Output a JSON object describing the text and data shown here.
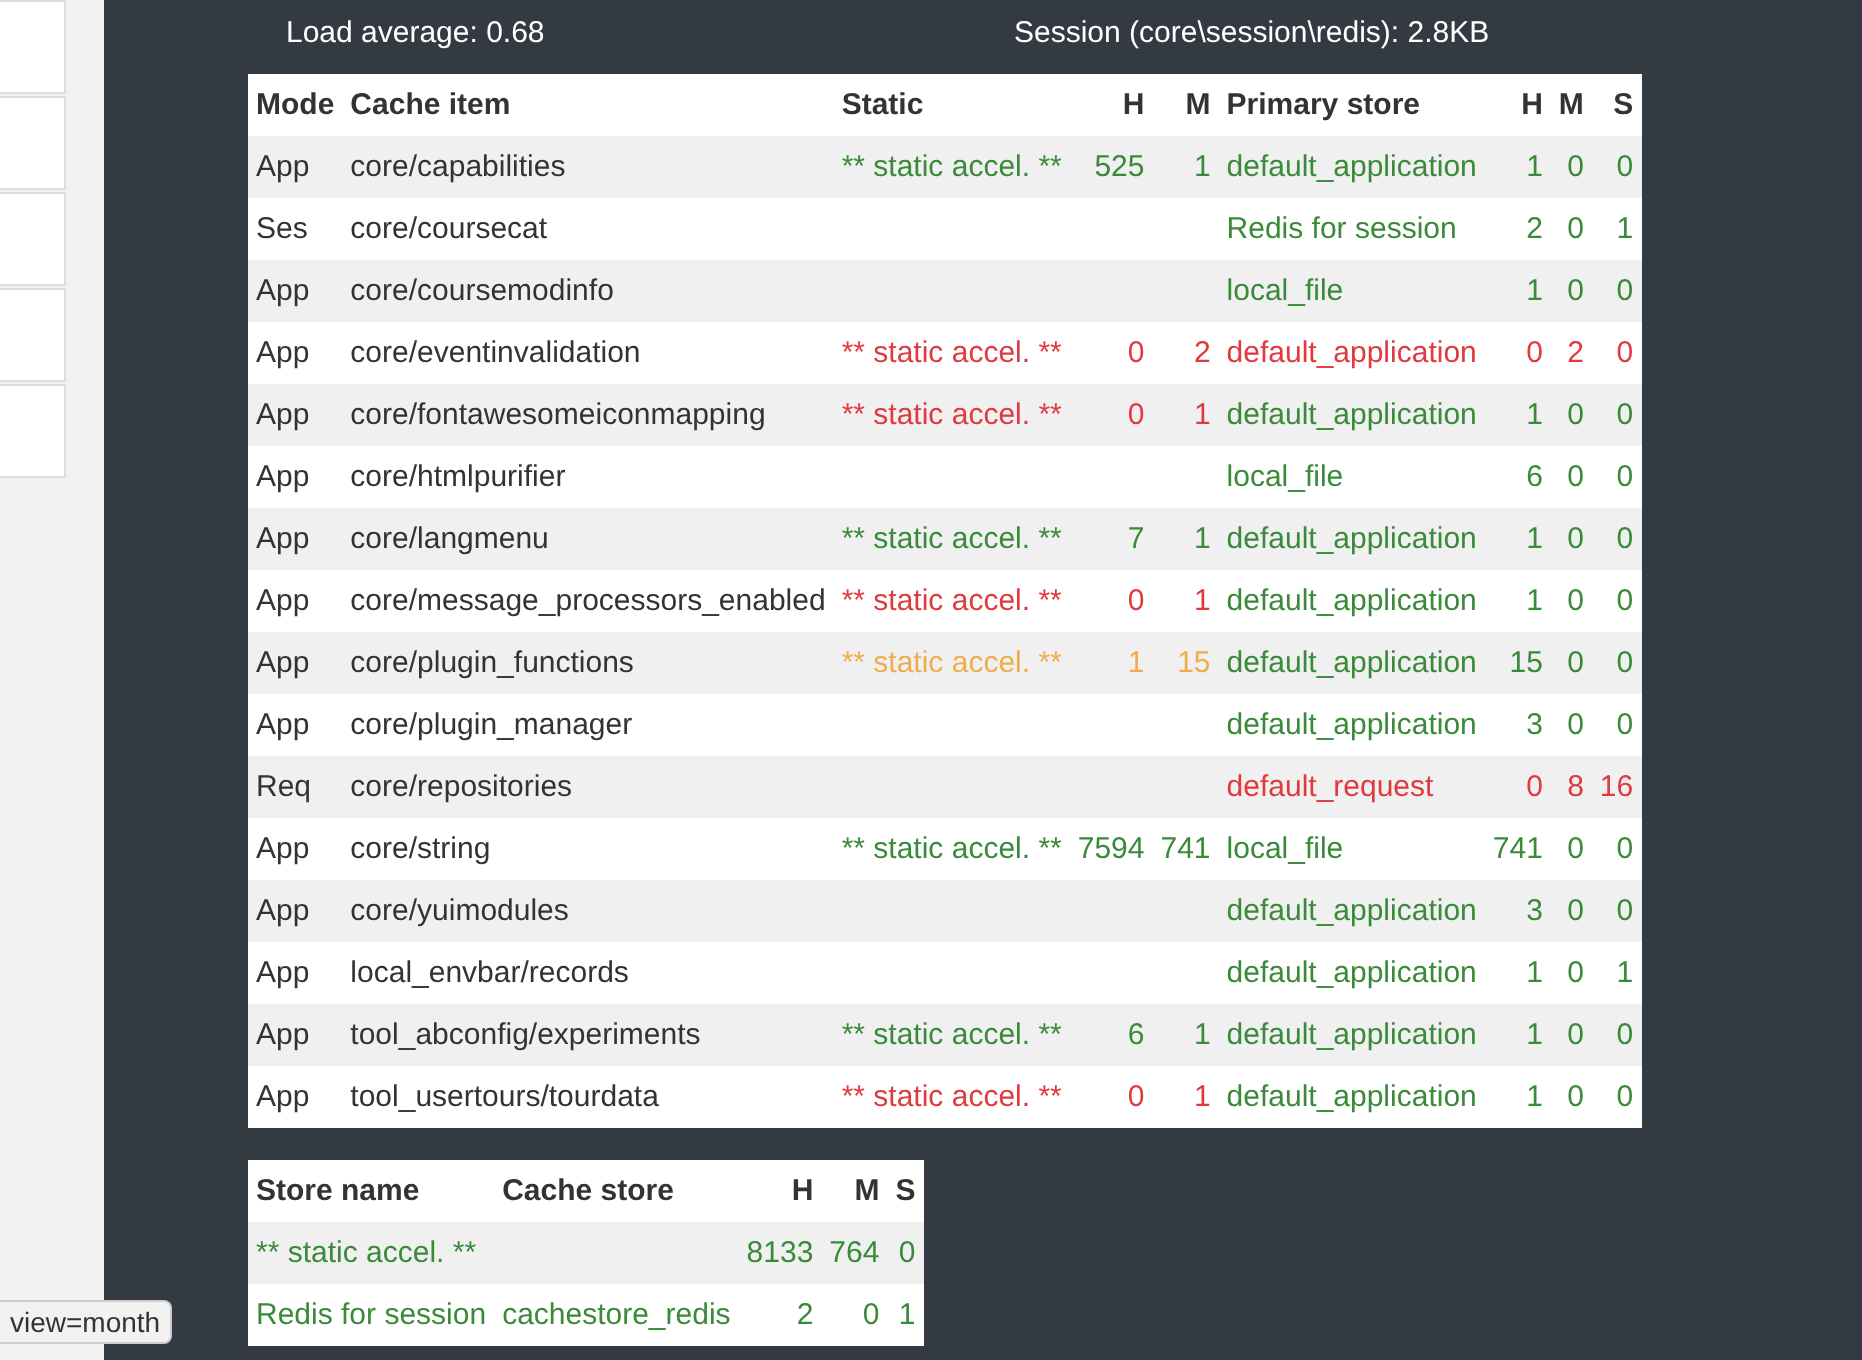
{
  "stats": {
    "left": "Load average: 0.68",
    "right": "Session (core\\session\\redis): 2.8KB"
  },
  "cache_table": {
    "columns": [
      "Mode",
      "Cache item",
      "Static",
      "H",
      "M",
      "Primary store",
      "H",
      "M",
      "S"
    ],
    "rows": [
      {
        "mode": "App",
        "item": "core/capabilities",
        "static": {
          "text": "** static accel. **",
          "h": "525",
          "m": "1",
          "color": "#3a8a3a"
        },
        "store": {
          "name": "default_application",
          "h": "1",
          "m": "0",
          "s": "0",
          "color": "#3a8a3a"
        }
      },
      {
        "mode": "Ses",
        "item": "core/coursecat",
        "store": {
          "name": "Redis for session",
          "h": "2",
          "m": "0",
          "s": "1",
          "color": "#3a8a3a"
        }
      },
      {
        "mode": "App",
        "item": "core/coursemodinfo",
        "store": {
          "name": "local_file",
          "h": "1",
          "m": "0",
          "s": "0",
          "color": "#3a8a3a"
        }
      },
      {
        "mode": "App",
        "item": "core/eventinvalidation",
        "static": {
          "text": "** static accel. **",
          "h": "0",
          "m": "2",
          "color": "#e0393e"
        },
        "store": {
          "name": "default_application",
          "h": "0",
          "m": "2",
          "s": "0",
          "color": "#e0393e"
        }
      },
      {
        "mode": "App",
        "item": "core/fontawesomeiconmapping",
        "static": {
          "text": "** static accel. **",
          "h": "0",
          "m": "1",
          "color": "#e0393e"
        },
        "store": {
          "name": "default_application",
          "h": "1",
          "m": "0",
          "s": "0",
          "color": "#3a8a3a"
        }
      },
      {
        "mode": "App",
        "item": "core/htmlpurifier",
        "store": {
          "name": "local_file",
          "h": "6",
          "m": "0",
          "s": "0",
          "color": "#3a8a3a"
        }
      },
      {
        "mode": "App",
        "item": "core/langmenu",
        "static": {
          "text": "** static accel. **",
          "h": "7",
          "m": "1",
          "color": "#3a8a3a"
        },
        "store": {
          "name": "default_application",
          "h": "1",
          "m": "0",
          "s": "0",
          "color": "#3a8a3a"
        }
      },
      {
        "mode": "App",
        "item": "core/message_processors_enabled",
        "static": {
          "text": "** static accel. **",
          "h": "0",
          "m": "1",
          "color": "#e0393e"
        },
        "store": {
          "name": "default_application",
          "h": "1",
          "m": "0",
          "s": "0",
          "color": "#3a8a3a"
        }
      },
      {
        "mode": "App",
        "item": "core/plugin_functions",
        "static": {
          "text": "** static accel. **",
          "h": "1",
          "m": "15",
          "color": "#f0ad4e"
        },
        "store": {
          "name": "default_application",
          "h": "15",
          "m": "0",
          "s": "0",
          "color": "#3a8a3a"
        }
      },
      {
        "mode": "App",
        "item": "core/plugin_manager",
        "store": {
          "name": "default_application",
          "h": "3",
          "m": "0",
          "s": "0",
          "color": "#3a8a3a"
        }
      },
      {
        "mode": "Req",
        "item": "core/repositories",
        "store": {
          "name": "default_request",
          "h": "0",
          "m": "8",
          "s": "16",
          "color": "#e0393e"
        }
      },
      {
        "mode": "App",
        "item": "core/string",
        "static": {
          "text": "** static accel. **",
          "h": "7594",
          "m": "741",
          "color": "#3a8a3a"
        },
        "store": {
          "name": "local_file",
          "h": "741",
          "m": "0",
          "s": "0",
          "color": "#3a8a3a"
        }
      },
      {
        "mode": "App",
        "item": "core/yuimodules",
        "store": {
          "name": "default_application",
          "h": "3",
          "m": "0",
          "s": "0",
          "color": "#3a8a3a"
        }
      },
      {
        "mode": "App",
        "item": "local_envbar/records",
        "store": {
          "name": "default_application",
          "h": "1",
          "m": "0",
          "s": "1",
          "color": "#3a8a3a"
        }
      },
      {
        "mode": "App",
        "item": "tool_abconfig/experiments",
        "static": {
          "text": "** static accel. **",
          "h": "6",
          "m": "1",
          "color": "#3a8a3a"
        },
        "store": {
          "name": "default_application",
          "h": "1",
          "m": "0",
          "s": "0",
          "color": "#3a8a3a"
        }
      },
      {
        "mode": "App",
        "item": "tool_usertours/tourdata",
        "static": {
          "text": "** static accel. **",
          "h": "0",
          "m": "1",
          "color": "#e0393e"
        },
        "store": {
          "name": "default_application",
          "h": "1",
          "m": "0",
          "s": "0",
          "color": "#3a8a3a"
        }
      }
    ]
  },
  "store_table": {
    "columns": [
      "Store name",
      "Cache store",
      "H",
      "M",
      "S"
    ],
    "rows": [
      {
        "name": "** static accel. **",
        "h": "8133",
        "m": "764",
        "s": "0",
        "color": "#3a8a3a"
      },
      {
        "name": "Redis for session",
        "plugin": "cachestore_redis",
        "h": "2",
        "m": "0",
        "s": "1",
        "color": "#3a8a3a"
      }
    ]
  },
  "tooltip": "view=month"
}
